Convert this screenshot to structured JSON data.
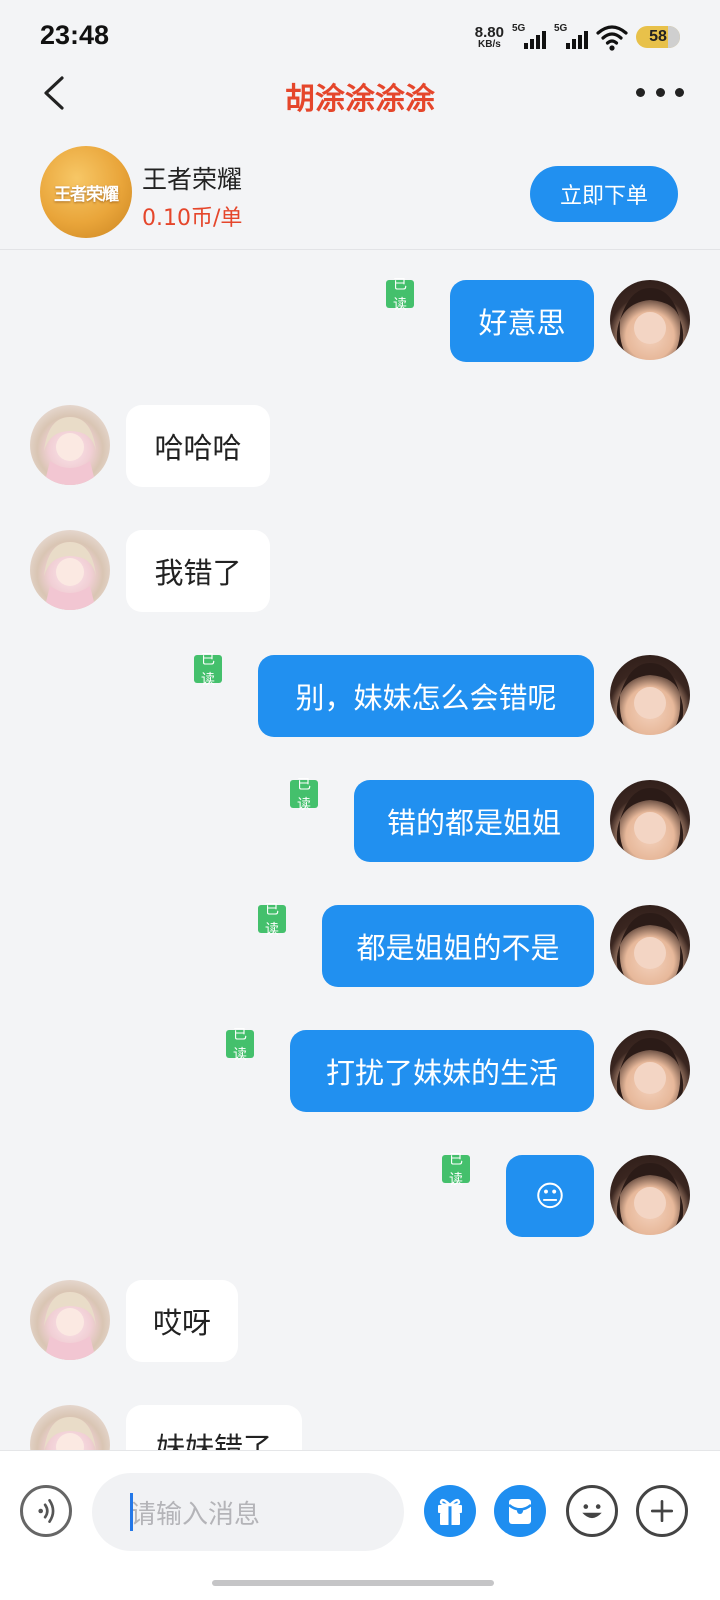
{
  "status_bar": {
    "time": "23:48",
    "net_speed_value": "8.80",
    "net_speed_unit": "KB/s",
    "sim1_label": "5G",
    "sim2_label": "5G",
    "battery": "58"
  },
  "nav": {
    "title": "胡涂涂涂涂",
    "back_icon": "chevron-left-icon",
    "more_icon": "more-horizontal-icon"
  },
  "product": {
    "logo_text": "王者荣耀",
    "name": "王者荣耀",
    "price": "0.10币/单",
    "order_button": "立即下单"
  },
  "messages": [
    {
      "from": "me",
      "text": "好意思",
      "read": "已读"
    },
    {
      "from": "her",
      "text": "哈哈哈"
    },
    {
      "from": "her",
      "text": "我错了"
    },
    {
      "from": "me",
      "text": "别，妹妹怎么会错呢",
      "read": "已读"
    },
    {
      "from": "me",
      "text": "错的都是姐姐",
      "read": "已读"
    },
    {
      "from": "me",
      "text": "都是姐姐的不是",
      "read": "已读"
    },
    {
      "from": "me",
      "text": "打扰了妹妹的生活",
      "read": "已读"
    },
    {
      "from": "me",
      "text": "😐",
      "read": "已读"
    },
    {
      "from": "her",
      "text": "哎呀"
    },
    {
      "from": "her",
      "text": "妹妹错了"
    }
  ],
  "composer": {
    "placeholder": "请输入消息",
    "voice_icon": "voice-icon",
    "gift_icon": "gift-icon",
    "red_packet_icon": "red-packet-icon",
    "emoji_icon": "emoji-icon",
    "plus_icon": "plus-icon"
  },
  "colors": {
    "accent_blue": "#2190f0",
    "title_red": "#e5462b",
    "read_green": "#44c06c",
    "background": "#f3f4f6"
  }
}
